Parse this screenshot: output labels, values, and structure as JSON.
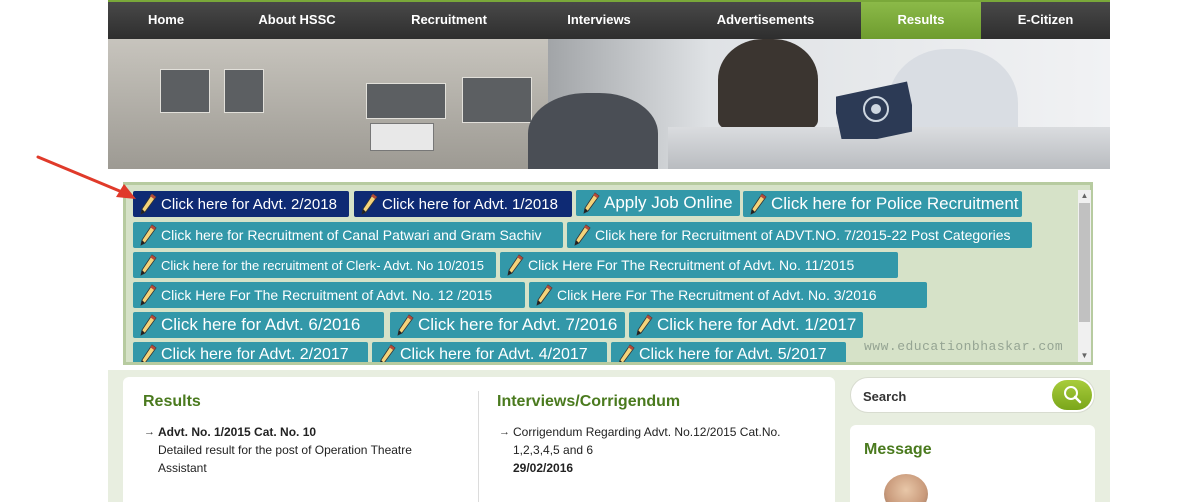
{
  "nav": {
    "items": [
      "Home",
      "About HSSC",
      "Recruitment",
      "Interviews",
      "Advertisements",
      "Results",
      "E-Citizen"
    ],
    "active": "Results"
  },
  "links": [
    {
      "label": "Click here for Advt. 2/2018",
      "style": "dark"
    },
    {
      "label": "Click here for Advt. 1/2018",
      "style": "dark"
    },
    {
      "label": "Apply Job Online",
      "style": "teal"
    },
    {
      "label": "Click here for Police Recruitment",
      "style": "teal"
    },
    {
      "label": "Click here for Recruitment of Canal Patwari and Gram Sachiv",
      "style": "teal"
    },
    {
      "label": "Click here for Recruitment of ADVT.NO. 7/2015-22 Post Categories",
      "style": "teal"
    },
    {
      "label": "Click here for the recruitment of Clerk- Advt. No 10/2015",
      "style": "teal"
    },
    {
      "label": "Click Here For The Recruitment of Advt. No. 11/2015",
      "style": "teal"
    },
    {
      "label": "Click Here For The Recruitment of Advt. No. 12 /2015",
      "style": "teal"
    },
    {
      "label": "Click Here For The Recruitment of Advt. No. 3/2016",
      "style": "teal"
    },
    {
      "label": "Click here for Advt. 6/2016",
      "style": "teal"
    },
    {
      "label": "Click here for Advt. 7/2016",
      "style": "teal"
    },
    {
      "label": "Click here for Advt. 1/2017",
      "style": "teal"
    },
    {
      "label": "Click here for Advt. 2/2017",
      "style": "teal"
    },
    {
      "label": "Click here for Advt. 4/2017",
      "style": "teal"
    },
    {
      "label": "Click here for Advt. 5/2017",
      "style": "teal"
    }
  ],
  "watermark": "www.educationbhaskar.com",
  "results": {
    "title": "Results",
    "item_heading": "Advt. No. 1/2015 Cat. No. 10",
    "item_text": "Detailed result for the post of Operation Theatre Assistant"
  },
  "interviews": {
    "title": "Interviews/Corrigendum",
    "item_text": "Corrigendum Regarding Advt. No.12/2015 Cat.No. 1,2,3,4,5 and 6",
    "item_date": "29/02/2016"
  },
  "search": {
    "placeholder": "Search"
  },
  "message": {
    "title": "Message"
  },
  "colors": {
    "accent_green": "#7aa83a",
    "link_teal": "#3398a9",
    "link_dark": "#0e2a74",
    "title_green": "#4a7a1e"
  },
  "icons": [
    "pencil-icon",
    "search-icon",
    "scroll-up-icon",
    "scroll-down-icon",
    "red-arrow-icon"
  ]
}
